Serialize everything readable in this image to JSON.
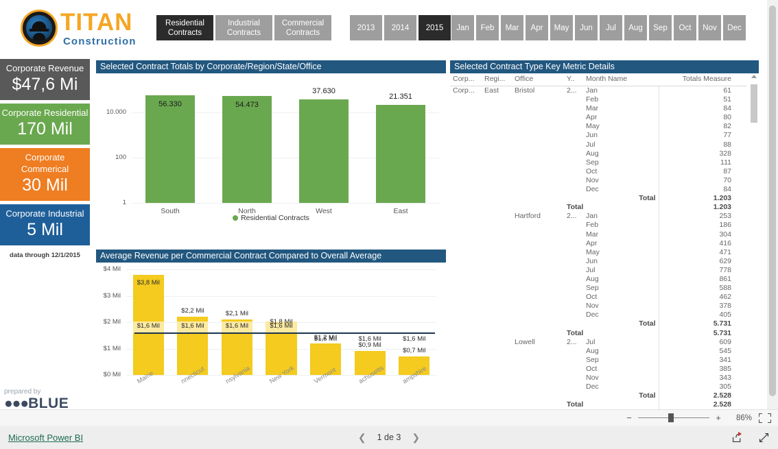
{
  "brand": {
    "name": "TITAN",
    "tagline": "Construction",
    "logo_icon": "hardhat-emblem-icon",
    "primary_color": "#f5a623",
    "secondary_color": "#2f6fa8"
  },
  "slicers": {
    "contract_type": {
      "options": [
        "Residential Contracts",
        "Industrial Contracts",
        "Commercial Contracts"
      ],
      "selected": "Residential Contracts"
    },
    "year": {
      "options": [
        "2013",
        "2014",
        "2015"
      ],
      "selected": "2015"
    },
    "month": {
      "options": [
        "Jan",
        "Feb",
        "Mar",
        "Apr",
        "May",
        "Jun",
        "Jul",
        "Aug",
        "Sep",
        "Oct",
        "Nov",
        "Dec"
      ],
      "selected": null
    }
  },
  "kpis": [
    {
      "title": "Corporate Revenue",
      "value": "$47,6 Mi",
      "color": "#595959"
    },
    {
      "title": "Corporate Residential",
      "value": "170 Mil",
      "color": "#6aa84f"
    },
    {
      "title": "Corporate Commerical",
      "value": "30 Mil",
      "color": "#ef7d22"
    },
    {
      "title": "Corporate Industrial",
      "value": "5 Mil",
      "color": "#1f5f99"
    }
  ],
  "kpi_note": "data through 12/1/2015",
  "prepared_by": {
    "label": "prepared by",
    "dots": "●●●",
    "brand": "BLUE"
  },
  "visuals": {
    "column_chart_title": "Selected Contract Totals by Corporate/Region/State/Office",
    "revenue_chart_title": "Average Revenue per Commercial Contract Compared to Overall Average",
    "matrix_title": "Selected Contract Type Key Metric Details"
  },
  "chart_data": [
    {
      "id": "contract-totals-by-region",
      "type": "bar",
      "title": "Selected Contract Totals by Corporate/Region/State/Office",
      "categories": [
        "South",
        "North",
        "West",
        "East"
      ],
      "values": [
        56330,
        54473,
        37630,
        21351
      ],
      "data_labels": [
        "56.330",
        "54.473",
        "37.630",
        "21.351"
      ],
      "series": [
        {
          "name": "Residential Contracts",
          "values": [
            56330,
            54473,
            37630,
            21351
          ],
          "color": "#6aa84f"
        }
      ],
      "legend": [
        "Residential Contracts"
      ],
      "legend_position": "bottom",
      "yscale": "log",
      "ytick_labels": [
        "10.000",
        "100",
        "1"
      ],
      "ytick_values": [
        10000,
        100,
        1
      ],
      "ylim": [
        1,
        100000
      ],
      "grid": true,
      "xlabel": "",
      "ylabel": ""
    },
    {
      "id": "avg-revenue-per-commercial-contract",
      "type": "bar",
      "title": "Average Revenue per Commercial Contract Compared to Overall Average",
      "categories": [
        "Maine",
        "Connecticut",
        "Pennsylvania",
        "New York",
        "Vermont",
        "Massachusetts",
        "New Hampshire"
      ],
      "category_display": [
        "Maine",
        "nnecticut",
        "nsylvania",
        "New York",
        "Vermont",
        "achusetts",
        "ampshire"
      ],
      "values": [
        3.8,
        2.2,
        2.1,
        1.8,
        1.2,
        0.9,
        0.7
      ],
      "data_labels": [
        "$3,8 Mil",
        "$2,2 Mil",
        "$2,1 Mil",
        "$1,8 Mil",
        "$1,2 Mil",
        "$0,9 Mil",
        "$0,7 Mil"
      ],
      "reference_line": {
        "label": "$1,6 Mil",
        "value": 1.6,
        "color": "#1c3350"
      },
      "reference_labels": [
        "$1,6 Mil",
        "$1,6 Mil",
        "$1,6 Mil",
        "$1,6 Mil",
        "$1,6 Mil",
        "$1,6 Mil",
        "$1,6 Mil"
      ],
      "bar_color": "#f4cb1e",
      "band_color": "#fbeaa0",
      "ytick_labels": [
        "$4 Mil",
        "$3 Mil",
        "$2 Mil",
        "$1 Mil",
        "$0 Mil"
      ],
      "ytick_values": [
        4,
        3,
        2,
        1,
        0
      ],
      "ylim": [
        0,
        4
      ],
      "grid": true,
      "xlabel": "",
      "ylabel": ""
    }
  ],
  "matrix": {
    "columns": [
      "Corp...",
      "Regi...",
      "Office",
      "Y..",
      "Month Name",
      "Totals Measure"
    ],
    "rows": [
      {
        "corp": "Corp...",
        "region": "East",
        "office": "Bristol",
        "year": "2...",
        "month": "Jan",
        "total": "61"
      },
      {
        "corp": "",
        "region": "",
        "office": "",
        "year": "",
        "month": "Feb",
        "total": "51"
      },
      {
        "corp": "",
        "region": "",
        "office": "",
        "year": "",
        "month": "Mar",
        "total": "84"
      },
      {
        "corp": "",
        "region": "",
        "office": "",
        "year": "",
        "month": "Apr",
        "total": "80"
      },
      {
        "corp": "",
        "region": "",
        "office": "",
        "year": "",
        "month": "May",
        "total": "82"
      },
      {
        "corp": "",
        "region": "",
        "office": "",
        "year": "",
        "month": "Jun",
        "total": "77"
      },
      {
        "corp": "",
        "region": "",
        "office": "",
        "year": "",
        "month": "Jul",
        "total": "88"
      },
      {
        "corp": "",
        "region": "",
        "office": "",
        "year": "",
        "month": "Aug",
        "total": "328"
      },
      {
        "corp": "",
        "region": "",
        "office": "",
        "year": "",
        "month": "Sep",
        "total": "111"
      },
      {
        "corp": "",
        "region": "",
        "office": "",
        "year": "",
        "month": "Oct",
        "total": "87"
      },
      {
        "corp": "",
        "region": "",
        "office": "",
        "year": "",
        "month": "Nov",
        "total": "70"
      },
      {
        "corp": "",
        "region": "",
        "office": "",
        "year": "",
        "month": "Dec",
        "total": "84"
      },
      {
        "corp": "",
        "region": "",
        "office": "",
        "year": "",
        "month": "Total",
        "total": "1.203",
        "is_total": true
      },
      {
        "corp": "",
        "region": "",
        "office": "",
        "year": "Total",
        "month": "",
        "total": "1.203",
        "is_total": true,
        "total_level": 2
      },
      {
        "corp": "",
        "region": "",
        "office": "Hartford",
        "year": "2...",
        "month": "Jan",
        "total": "253"
      },
      {
        "corp": "",
        "region": "",
        "office": "",
        "year": "",
        "month": "Feb",
        "total": "186"
      },
      {
        "corp": "",
        "region": "",
        "office": "",
        "year": "",
        "month": "Mar",
        "total": "304"
      },
      {
        "corp": "",
        "region": "",
        "office": "",
        "year": "",
        "month": "Apr",
        "total": "416"
      },
      {
        "corp": "",
        "region": "",
        "office": "",
        "year": "",
        "month": "May",
        "total": "471"
      },
      {
        "corp": "",
        "region": "",
        "office": "",
        "year": "",
        "month": "Jun",
        "total": "629"
      },
      {
        "corp": "",
        "region": "",
        "office": "",
        "year": "",
        "month": "Jul",
        "total": "778"
      },
      {
        "corp": "",
        "region": "",
        "office": "",
        "year": "",
        "month": "Aug",
        "total": "861"
      },
      {
        "corp": "",
        "region": "",
        "office": "",
        "year": "",
        "month": "Sep",
        "total": "588"
      },
      {
        "corp": "",
        "region": "",
        "office": "",
        "year": "",
        "month": "Oct",
        "total": "462"
      },
      {
        "corp": "",
        "region": "",
        "office": "",
        "year": "",
        "month": "Nov",
        "total": "378"
      },
      {
        "corp": "",
        "region": "",
        "office": "",
        "year": "",
        "month": "Dec",
        "total": "405"
      },
      {
        "corp": "",
        "region": "",
        "office": "",
        "year": "",
        "month": "Total",
        "total": "5.731",
        "is_total": true
      },
      {
        "corp": "",
        "region": "",
        "office": "",
        "year": "Total",
        "month": "",
        "total": "5.731",
        "is_total": true,
        "total_level": 2
      },
      {
        "corp": "",
        "region": "",
        "office": "Lowell",
        "year": "2...",
        "month": "Jul",
        "total": "609"
      },
      {
        "corp": "",
        "region": "",
        "office": "",
        "year": "",
        "month": "Aug",
        "total": "545"
      },
      {
        "corp": "",
        "region": "",
        "office": "",
        "year": "",
        "month": "Sep",
        "total": "341"
      },
      {
        "corp": "",
        "region": "",
        "office": "",
        "year": "",
        "month": "Oct",
        "total": "385"
      },
      {
        "corp": "",
        "region": "",
        "office": "",
        "year": "",
        "month": "Nov",
        "total": "343"
      },
      {
        "corp": "",
        "region": "",
        "office": "",
        "year": "",
        "month": "Dec",
        "total": "305"
      },
      {
        "corp": "",
        "region": "",
        "office": "",
        "year": "",
        "month": "Total",
        "total": "2.528",
        "is_total": true
      },
      {
        "corp": "",
        "region": "",
        "office": "",
        "year": "Total",
        "month": "",
        "total": "2.528",
        "is_total": true,
        "total_level": 2
      }
    ]
  },
  "statusbar": {
    "zoom_out_label": "−",
    "zoom_in_label": "+",
    "zoom_percent": "86%",
    "fit_icon": "fit-to-page-icon"
  },
  "footer": {
    "brand_link": "Microsoft Power BI",
    "prev_icon": "chevron-left-icon",
    "next_icon": "chevron-right-icon",
    "page_label": "1 de 3",
    "share_icon": "share-icon",
    "fullscreen_icon": "fullscreen-icon"
  }
}
